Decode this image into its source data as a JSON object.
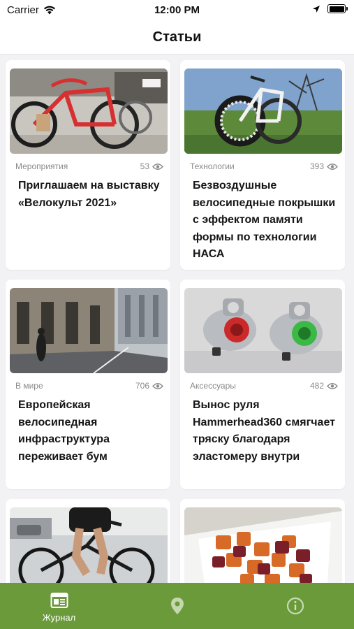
{
  "status_bar": {
    "carrier": "Carrier",
    "time": "12:00 PM"
  },
  "nav": {
    "title": "Статьи"
  },
  "articles": [
    {
      "category": "Мероприятия",
      "views": "53",
      "title": "Приглашаем на выставку «Велокульт 2021»",
      "image": "custom-bicycles-photo"
    },
    {
      "category": "Технологии",
      "views": "393",
      "title": "Безвоздушные велосипедные покрышки с эффектом памяти формы по технологии НАСА",
      "image": "airless-tire-bike-photo"
    },
    {
      "category": "В мире",
      "views": "706",
      "title": "Европейская велосипедная инфраструктура переживает бум",
      "image": "city-street-photo"
    },
    {
      "category": "Аксессуары",
      "views": "482",
      "title": "Вынос руля Hammerhead360 смягчает тряску благодаря эластомеру внутри",
      "image": "handlebar-stem-photo"
    },
    {
      "category": "",
      "views": "",
      "title": "",
      "image": "cyclist-photo"
    },
    {
      "category": "",
      "views": "",
      "title": "",
      "image": "food-bowl-photo"
    }
  ],
  "tab_bar": {
    "tabs": [
      {
        "label": "Журнал",
        "icon": "journal-icon",
        "active": true
      },
      {
        "label": "",
        "icon": "map-pin-icon",
        "active": false
      },
      {
        "label": "",
        "icon": "info-icon",
        "active": false
      }
    ],
    "color": "#6b9a3a"
  }
}
